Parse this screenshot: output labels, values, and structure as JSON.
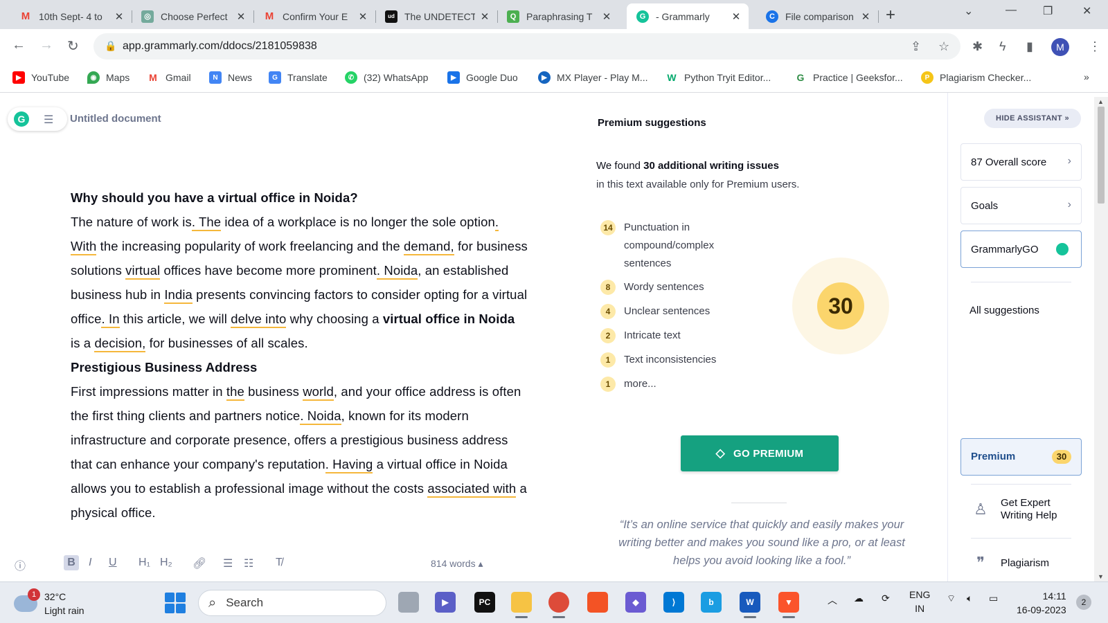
{
  "browser": {
    "tabs": [
      {
        "title": "10th Sept- 4 to",
        "icon": "gmail-icon",
        "color": "#ea4335",
        "glyph": "M"
      },
      {
        "title": "Choose Perfect",
        "icon": "chatgpt-icon",
        "color": "#74aa9c",
        "glyph": "◎"
      },
      {
        "title": "Confirm Your E",
        "icon": "gmail-icon",
        "color": "#ea4335",
        "glyph": "M"
      },
      {
        "title": "The UNDETECT",
        "icon": "ud-icon",
        "color": "#111111",
        "glyph": "ud"
      },
      {
        "title": "Paraphrasing T",
        "icon": "quillbot-icon",
        "color": "#4caf50",
        "glyph": "Q"
      },
      {
        "title": "- Grammarly",
        "icon": "grammarly-icon",
        "color": "#15c39a",
        "glyph": "G"
      },
      {
        "title": "File comparison",
        "icon": "copyleaks-icon",
        "color": "#1a73e8",
        "glyph": "C"
      }
    ],
    "url": "app.grammarly.com/ddocs/2181059838",
    "profile_initial": "M",
    "bookmarks": [
      {
        "label": "YouTube",
        "color": "#ff0000",
        "glyph": "▶"
      },
      {
        "label": "Maps",
        "color": "#34a853",
        "glyph": "◉"
      },
      {
        "label": "Gmail",
        "color": "#ea4335",
        "glyph": "M"
      },
      {
        "label": "News",
        "color": "#4285f4",
        "glyph": "N"
      },
      {
        "label": "Translate",
        "color": "#4285f4",
        "glyph": "G"
      },
      {
        "label": "(32) WhatsApp",
        "color": "#25d366",
        "glyph": "✆"
      },
      {
        "label": "Google Duo",
        "color": "#1a73e8",
        "glyph": "▶"
      },
      {
        "label": "MX Player - Play M...",
        "color": "#1565c0",
        "glyph": "▶"
      },
      {
        "label": "Python Tryit Editor...",
        "color": "#04aa6d",
        "glyph": "W"
      },
      {
        "label": "Practice | Geeksfor...",
        "color": "#2f8d46",
        "glyph": "G"
      },
      {
        "label": "Plagiarism Checker...",
        "color": "#f5c518",
        "glyph": "P"
      }
    ]
  },
  "editor": {
    "doc_title": "Untitled document",
    "word_count": "814 words ▴"
  },
  "premium": {
    "title": "Premium suggestions",
    "found_prefix": "We found ",
    "found_bold": "30 additional writing issues",
    "found_line2": "in this text available only for Premium users.",
    "issues": [
      {
        "count": "14",
        "label": "Punctuation in compound/complex sentences"
      },
      {
        "count": "8",
        "label": "Wordy sentences"
      },
      {
        "count": "4",
        "label": "Unclear sentences"
      },
      {
        "count": "2",
        "label": "Intricate text"
      },
      {
        "count": "1",
        "label": "Text inconsistencies"
      },
      {
        "count": "1",
        "label": "more..."
      }
    ],
    "total": "30",
    "cta": "GO PREMIUM",
    "quote": "“It’s an online service that quickly and easily makes your writing better and makes you sound like a pro, or at least helps you avoid looking like a fool.”"
  },
  "sidebar": {
    "hide_label": "HIDE ASSISTANT",
    "overall_score": "87 Overall score",
    "goals": "Goals",
    "grammarly_go": "GrammarlyGO",
    "all_suggestions": "All suggestions",
    "premium_label": "Premium",
    "premium_count": "30",
    "expert_help": "Get Expert Writing Help",
    "plagiarism": "Plagiarism"
  },
  "taskbar": {
    "weather_badge": "1",
    "temperature": "32°C",
    "condition": "Light rain",
    "search_placeholder": "Search",
    "lang1": "ENG",
    "lang2": "IN",
    "time": "14:11",
    "date": "16-09-2023",
    "notifications": "2"
  },
  "colors": {
    "grammarly_green": "#15a180",
    "underline": "#f5b73b",
    "score_yellow": "#fbd56c"
  }
}
